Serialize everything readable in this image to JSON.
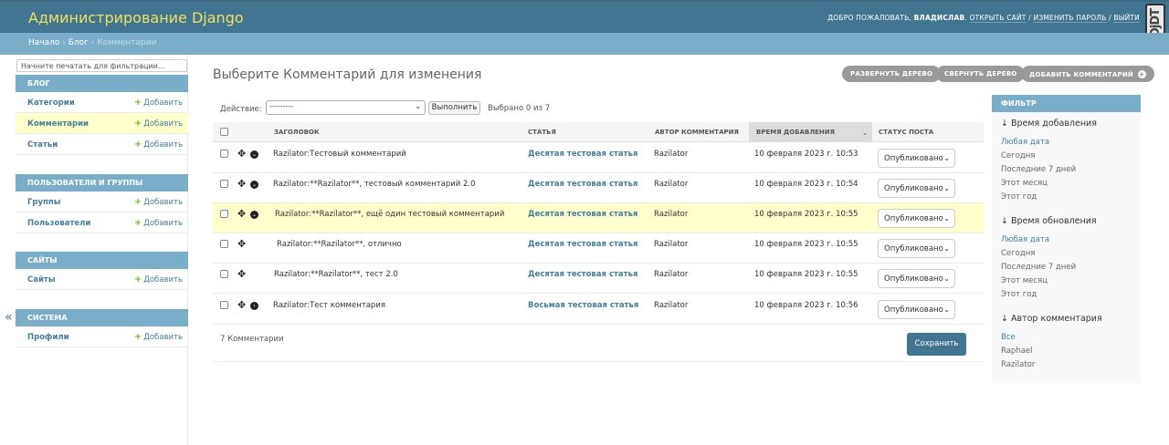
{
  "header": {
    "branding": "Администрирование Django",
    "welcome": "Добро пожаловать,",
    "username": "Владислав",
    "view_site": "Открыть сайт",
    "change_password": "Изменить пароль",
    "logout": "Выйти",
    "separator": "/",
    "djdt": "DjDT"
  },
  "breadcrumbs": {
    "home": "Начало",
    "app": "Блог",
    "current": "Комментарии",
    "sep": "›"
  },
  "nav": {
    "filter_placeholder": "Начните печатать для фильтрации...",
    "toggle": "«",
    "add_label": "Добавить",
    "apps": [
      {
        "caption": "Блог",
        "models": [
          "Категории",
          "Комментарии",
          "Статьи"
        ]
      },
      {
        "caption": "Пользователи и группы",
        "models": [
          "Группы",
          "Пользователи"
        ]
      },
      {
        "caption": "Сайты",
        "models": [
          "Сайты"
        ]
      },
      {
        "caption": "Система",
        "models": [
          "Профили"
        ]
      }
    ]
  },
  "content": {
    "title": "Выберите Комментарий для изменения",
    "tools": [
      "Развернуть дерево",
      "Свернуть дерево",
      "Добавить комментарий"
    ]
  },
  "actions": {
    "label": "Действие:",
    "select_value": "---------",
    "go": "Выполнить",
    "counter": "Выбрано 0 из 7"
  },
  "table": {
    "columns": [
      "Заголовок",
      "Статья",
      "Автор комментария",
      "Время добавления",
      "Статус поста"
    ],
    "rows": [
      {
        "title": "Razilator:Тестовый комментарий",
        "article": "Десятая тестовая статья",
        "author": "Razilator",
        "time": "10 февраля 2023 г. 10:53",
        "status": "Опубликовано"
      },
      {
        "title": "Razilator:**Razilator**, тестовый комментарий 2.0",
        "article": "Десятая тестовая статья",
        "author": "Razilator",
        "time": "10 февраля 2023 г. 10:54",
        "status": "Опубликовано"
      },
      {
        "title": "Razilator:**Razilator**, ещё один тестовый комментарий",
        "article": "Десятая тестовая статья",
        "author": "Razilator",
        "time": "10 февраля 2023 г. 10:55",
        "status": "Опубликовано"
      },
      {
        "title": "Razilator:**Razilator**, отлично",
        "article": "Десятая тестовая статья",
        "author": "Razilator",
        "time": "10 февраля 2023 г. 10:55",
        "status": "Опубликовано"
      },
      {
        "title": "Razilator:**Razilator**, тест 2.0",
        "article": "Десятая тестовая статья",
        "author": "Razilator",
        "time": "10 февраля 2023 г. 10:55",
        "status": "Опубликовано"
      },
      {
        "title": "Razilator:Тест комментария",
        "article": "Восьмая тестовая статья",
        "author": "Razilator",
        "time": "10 февраля 2023 г. 10:56",
        "status": "Опубликовано"
      }
    ],
    "count_text": "7 Комментарии",
    "save": "Сохранить"
  },
  "filter": {
    "caption": "Фильтр",
    "groups": [
      {
        "title": "↓ Время добавления",
        "options": [
          "Любая дата",
          "Сегодня",
          "Последние 7 дней",
          "Этот месяц",
          "Этот год"
        ]
      },
      {
        "title": "↓ Время обновления",
        "options": [
          "Любая дата",
          "Сегодня",
          "Последние 7 дней",
          "Этот месяц",
          "Этот год"
        ]
      },
      {
        "title": "↓ Автор комментария",
        "options": [
          "Все",
          "Raphael",
          "Razilator"
        ]
      }
    ]
  },
  "colors": {
    "header": "#417690",
    "branding": "#f5dd5d",
    "caption": "#79aec8",
    "link": "#447e9b",
    "selected_row": "#ffffcc",
    "add_plus": "#70bf2b"
  }
}
